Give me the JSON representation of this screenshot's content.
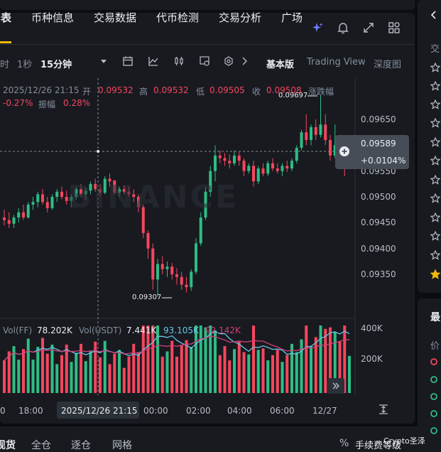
{
  "tabs": [
    {
      "label": "图表",
      "active": true
    },
    {
      "label": "币种信息"
    },
    {
      "label": "交易数据"
    },
    {
      "label": "代币检测"
    },
    {
      "label": "交易分析"
    },
    {
      "label": "广场"
    }
  ],
  "toolbar": {
    "time_partial": "时",
    "one_sec": "1秒",
    "interval": "15分钟",
    "basic": "基本版",
    "tradingview": "Trading View",
    "depth": "深度图"
  },
  "ohlc": {
    "datetime": "2025/12/26 21:15",
    "open_label": "开",
    "open": "0.09532",
    "high_label": "高",
    "high": "0.09532",
    "low_label": "低",
    "low": "0.09505",
    "close_label": "收",
    "close": "0.09508",
    "change_label": "涨跌幅",
    "change": "-0.27%",
    "amp_label": "振幅",
    "amp": "0.28%"
  },
  "price_axis": [
    "0.09650",
    "0.09550",
    "0.09500",
    "0.09450",
    "0.09400",
    "0.09350"
  ],
  "current_price": {
    "value": "0.09589",
    "change": "+0.0104%"
  },
  "annotations": {
    "high": "0.09697",
    "low": "0.09307"
  },
  "volume": {
    "label_ff": "Vol(FF)",
    "ff": "78.202K",
    "label_usdt": "Vol(USDT)",
    "usdt": "7.441K",
    "ma1": "93.105K",
    "ma2": "92.142K",
    "axis_top": "400K",
    "axis_mid": "200K"
  },
  "time_axis": [
    "0",
    "18:00",
    "2025/12/26 21:15",
    "00:00",
    "02:00",
    "04:00",
    "06:00",
    "12/27"
  ],
  "bottom_tabs": [
    "现货",
    "全仓",
    "逐仓",
    "网格"
  ],
  "bottom_right": {
    "percent": "%",
    "fee": "手续费等级",
    "watermark": "Crypto圣泽"
  },
  "right_panel": {
    "label_jiao": "交",
    "label_zui": "最",
    "label_jia": "价"
  },
  "watermark": "BINANCE",
  "colors": {
    "up": "#2ebd85",
    "down": "#f6465d",
    "accent": "#f0b90b"
  },
  "chart_data": {
    "type": "candlestick",
    "price_range": [
      0.0929,
      0.0972
    ],
    "candles": [
      [
        0.0946,
        0.09475,
        0.09445,
        0.09455
      ],
      [
        0.09455,
        0.0947,
        0.0944,
        0.09448
      ],
      [
        0.09448,
        0.09465,
        0.0944,
        0.0946
      ],
      [
        0.0946,
        0.09478,
        0.0945,
        0.0947
      ],
      [
        0.0947,
        0.09485,
        0.09455,
        0.0946
      ],
      [
        0.0946,
        0.0949,
        0.09458,
        0.09485
      ],
      [
        0.09485,
        0.095,
        0.09475,
        0.0949
      ],
      [
        0.0949,
        0.0951,
        0.0948,
        0.09505
      ],
      [
        0.09505,
        0.09515,
        0.09485,
        0.0949
      ],
      [
        0.0949,
        0.095,
        0.0947,
        0.09478
      ],
      [
        0.09478,
        0.09505,
        0.09475,
        0.095
      ],
      [
        0.095,
        0.09515,
        0.0949,
        0.0951
      ],
      [
        0.0951,
        0.0952,
        0.09495,
        0.095
      ],
      [
        0.095,
        0.09512,
        0.09485,
        0.09492
      ],
      [
        0.09492,
        0.09505,
        0.0948,
        0.095
      ],
      [
        0.095,
        0.0952,
        0.09495,
        0.09515
      ],
      [
        0.09515,
        0.09525,
        0.095,
        0.09505
      ],
      [
        0.09505,
        0.09518,
        0.09495,
        0.09512
      ],
      [
        0.09512,
        0.0953,
        0.09505,
        0.09525
      ],
      [
        0.09525,
        0.09535,
        0.0951,
        0.09515
      ],
      [
        0.09515,
        0.09525,
        0.095,
        0.09508
      ],
      [
        0.09508,
        0.0954,
        0.09505,
        0.09535
      ],
      [
        0.09535,
        0.09545,
        0.0952,
        0.0953
      ],
      [
        0.09532,
        0.09532,
        0.09505,
        0.09508
      ],
      [
        0.09508,
        0.0952,
        0.095,
        0.09515
      ],
      [
        0.09515,
        0.09522,
        0.09505,
        0.0951
      ],
      [
        0.0951,
        0.0952,
        0.095,
        0.09505
      ],
      [
        0.09505,
        0.09515,
        0.0949,
        0.095
      ],
      [
        0.095,
        0.09505,
        0.0947,
        0.0948
      ],
      [
        0.0948,
        0.09485,
        0.0942,
        0.0943
      ],
      [
        0.0943,
        0.09435,
        0.0938,
        0.094
      ],
      [
        0.094,
        0.0941,
        0.0932,
        0.0934
      ],
      [
        0.0934,
        0.0938,
        0.09307,
        0.0937
      ],
      [
        0.0937,
        0.09385,
        0.0935,
        0.0936
      ],
      [
        0.0936,
        0.09375,
        0.09345,
        0.09365
      ],
      [
        0.09365,
        0.09372,
        0.0934,
        0.0935
      ],
      [
        0.0935,
        0.09362,
        0.0933,
        0.09345
      ],
      [
        0.09345,
        0.09355,
        0.0932,
        0.0933
      ],
      [
        0.0933,
        0.09345,
        0.09315,
        0.09325
      ],
      [
        0.09325,
        0.0936,
        0.09318,
        0.09355
      ],
      [
        0.09355,
        0.0942,
        0.0935,
        0.0941
      ],
      [
        0.0941,
        0.0947,
        0.09405,
        0.0946
      ],
      [
        0.0946,
        0.0952,
        0.09455,
        0.0951
      ],
      [
        0.0951,
        0.0956,
        0.095,
        0.0955
      ],
      [
        0.0955,
        0.096,
        0.0953,
        0.0958
      ],
      [
        0.0958,
        0.0959,
        0.09565,
        0.09575
      ],
      [
        0.09575,
        0.09585,
        0.0956,
        0.0957
      ],
      [
        0.0957,
        0.09582,
        0.09555,
        0.09565
      ],
      [
        0.09565,
        0.0959,
        0.0956,
        0.0958
      ],
      [
        0.0958,
        0.09588,
        0.0956,
        0.0957
      ],
      [
        0.0957,
        0.09575,
        0.0954,
        0.0955
      ],
      [
        0.0955,
        0.09565,
        0.09545,
        0.0956
      ],
      [
        0.0956,
        0.0957,
        0.0952,
        0.0953
      ],
      [
        0.0953,
        0.0956,
        0.09525,
        0.09555
      ],
      [
        0.09555,
        0.09565,
        0.0954,
        0.09545
      ],
      [
        0.09545,
        0.0957,
        0.0954,
        0.09565
      ],
      [
        0.09565,
        0.09575,
        0.0955,
        0.09555
      ],
      [
        0.09555,
        0.09565,
        0.09545,
        0.0955
      ],
      [
        0.0955,
        0.09565,
        0.0954,
        0.0956
      ],
      [
        0.0956,
        0.0957,
        0.09548,
        0.09555
      ],
      [
        0.09555,
        0.09575,
        0.0955,
        0.0957
      ],
      [
        0.0957,
        0.096,
        0.09565,
        0.09595
      ],
      [
        0.09595,
        0.0963,
        0.0959,
        0.09625
      ],
      [
        0.09625,
        0.0966,
        0.096,
        0.0961
      ],
      [
        0.0961,
        0.0964,
        0.096,
        0.09635
      ],
      [
        0.09635,
        0.0965,
        0.0961,
        0.0962
      ],
      [
        0.0962,
        0.09697,
        0.09615,
        0.0964
      ],
      [
        0.0964,
        0.0966,
        0.096,
        0.0961
      ],
      [
        0.0961,
        0.0962,
        0.0957,
        0.0958
      ],
      [
        0.0958,
        0.0964,
        0.09575,
        0.096
      ],
      [
        0.096,
        0.0961,
        0.0957,
        0.0958
      ],
      [
        0.0958,
        0.09595,
        0.0954,
        0.0957
      ],
      [
        0.0957,
        0.0959,
        0.0956,
        0.09589
      ]
    ]
  }
}
